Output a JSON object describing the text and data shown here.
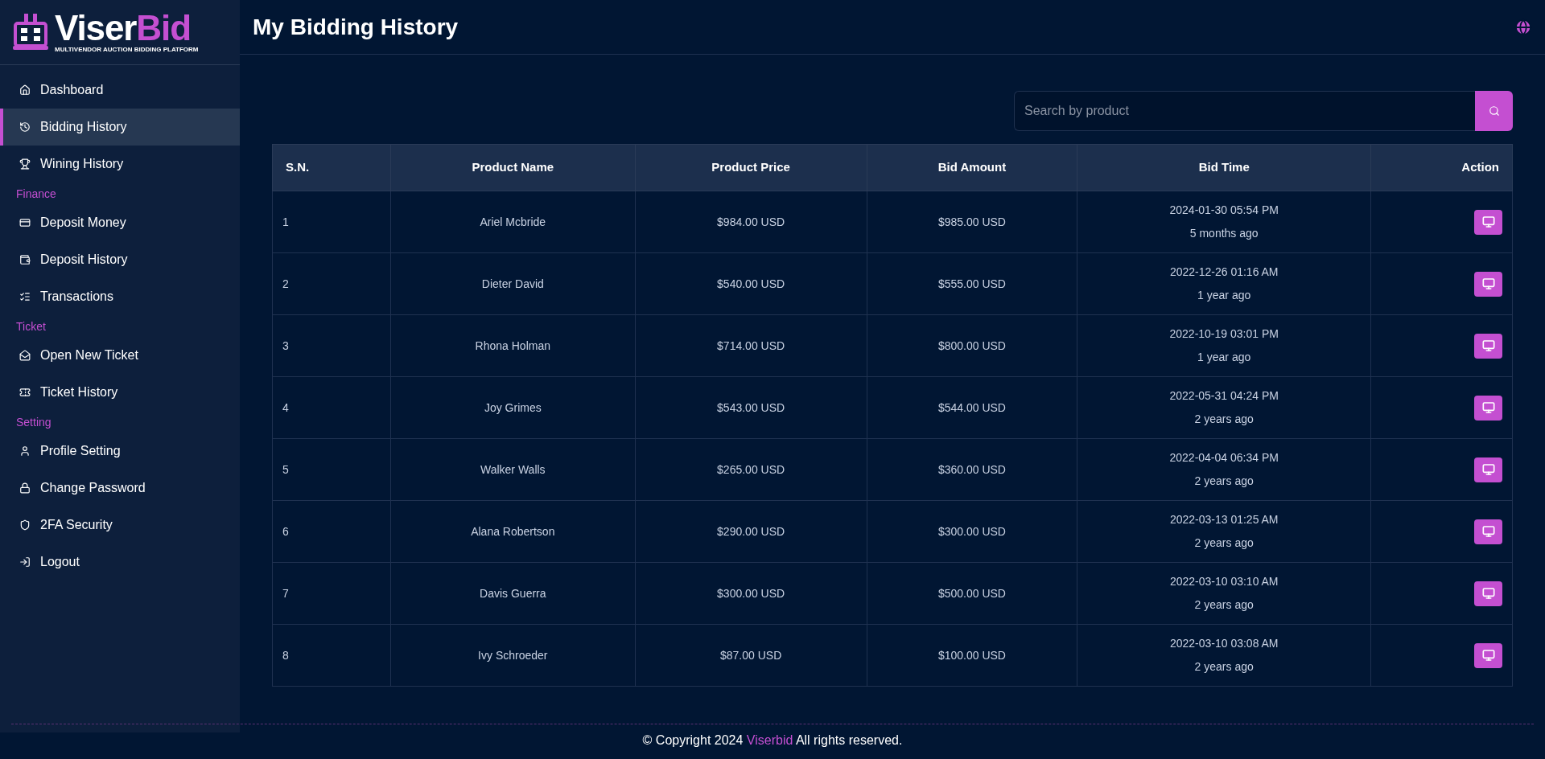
{
  "logo": {
    "name_start": "Viser",
    "name_end": "Bid",
    "tagline": "MULTIVENDOR AUCTION BIDDING PLATFORM"
  },
  "sidebar": {
    "items": [
      {
        "kind": "link",
        "label": "Dashboard",
        "selected": false
      },
      {
        "kind": "link",
        "label": "Bidding History",
        "selected": true
      },
      {
        "kind": "link",
        "label": "Wining History",
        "selected": false
      },
      {
        "kind": "heading",
        "label": "Finance"
      },
      {
        "kind": "link",
        "label": "Deposit Money",
        "selected": false
      },
      {
        "kind": "link",
        "label": "Deposit History",
        "selected": false
      },
      {
        "kind": "link",
        "label": "Transactions",
        "selected": false
      },
      {
        "kind": "heading",
        "label": "Ticket"
      },
      {
        "kind": "link",
        "label": "Open New Ticket",
        "selected": false
      },
      {
        "kind": "link",
        "label": "Ticket History",
        "selected": false
      },
      {
        "kind": "heading",
        "label": "Setting"
      },
      {
        "kind": "link",
        "label": "Profile Setting",
        "selected": false
      },
      {
        "kind": "link",
        "label": "Change Password",
        "selected": false
      },
      {
        "kind": "link",
        "label": "2FA Security",
        "selected": false
      },
      {
        "kind": "link",
        "label": "Logout",
        "selected": false
      }
    ]
  },
  "header": {
    "title": "My Bidding History"
  },
  "search": {
    "placeholder": "Search by product"
  },
  "table": {
    "columns": [
      "S.N.",
      "Product Name",
      "Product Price",
      "Bid Amount",
      "Bid Time",
      "Action"
    ],
    "rows": [
      {
        "sn": "1",
        "product": "Ariel Mcbride",
        "price": "$984.00 USD",
        "bid": "$985.00 USD",
        "time": "2024-01-30 05:54 PM",
        "ago": "5 months ago"
      },
      {
        "sn": "2",
        "product": "Dieter David",
        "price": "$540.00 USD",
        "bid": "$555.00 USD",
        "time": "2022-12-26 01:16 AM",
        "ago": "1 year ago"
      },
      {
        "sn": "3",
        "product": "Rhona Holman",
        "price": "$714.00 USD",
        "bid": "$800.00 USD",
        "time": "2022-10-19 03:01 PM",
        "ago": "1 year ago"
      },
      {
        "sn": "4",
        "product": "Joy Grimes",
        "price": "$543.00 USD",
        "bid": "$544.00 USD",
        "time": "2022-05-31 04:24 PM",
        "ago": "2 years ago"
      },
      {
        "sn": "5",
        "product": "Walker Walls",
        "price": "$265.00 USD",
        "bid": "$360.00 USD",
        "time": "2022-04-04 06:34 PM",
        "ago": "2 years ago"
      },
      {
        "sn": "6",
        "product": "Alana Robertson",
        "price": "$290.00 USD",
        "bid": "$300.00 USD",
        "time": "2022-03-13 01:25 AM",
        "ago": "2 years ago"
      },
      {
        "sn": "7",
        "product": "Davis Guerra",
        "price": "$300.00 USD",
        "bid": "$500.00 USD",
        "time": "2022-03-10 03:10 AM",
        "ago": "2 years ago"
      },
      {
        "sn": "8",
        "product": "Ivy Schroeder",
        "price": "$87.00 USD",
        "bid": "$100.00 USD",
        "time": "2022-03-10 03:08 AM",
        "ago": "2 years ago"
      }
    ]
  },
  "footer": {
    "before": "© Copyright 2024",
    "link": "Viserbid",
    "after": "All rights reserved."
  }
}
